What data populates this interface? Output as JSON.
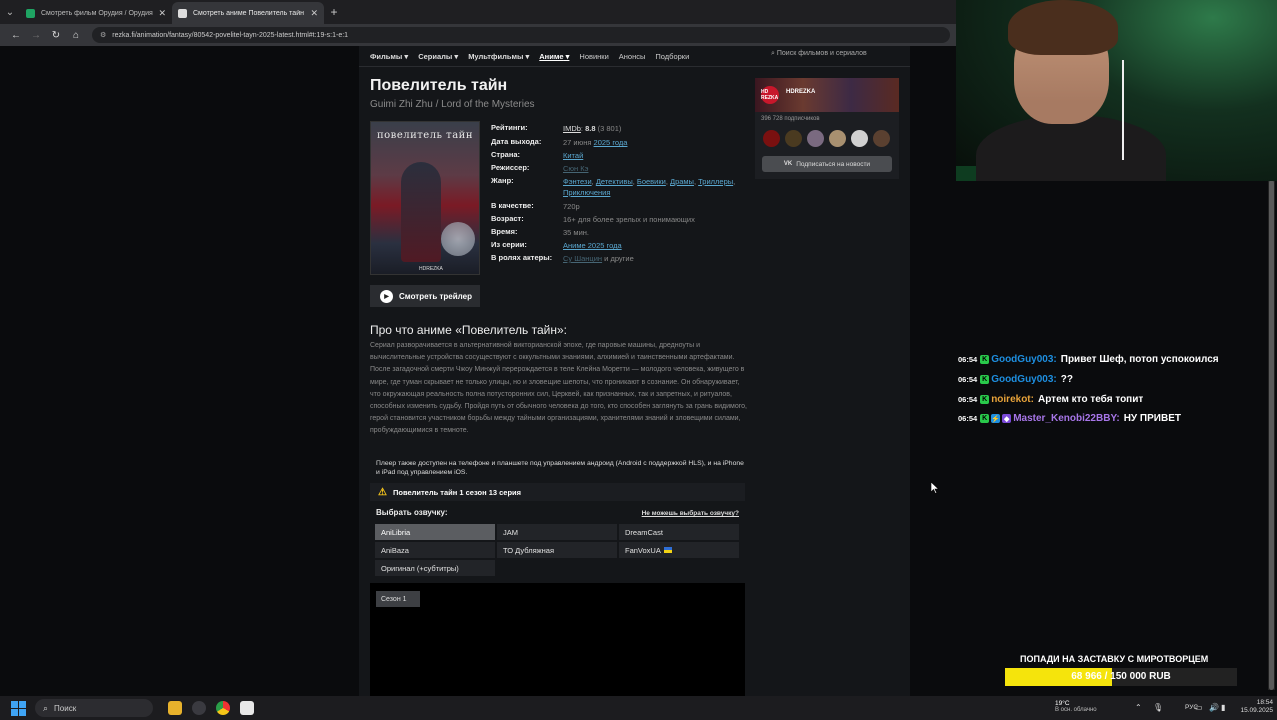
{
  "browser": {
    "tabs": [
      {
        "title": "Смотреть фильм Орудия / Орудия",
        "favicon_color": "#1fa463",
        "active": false
      },
      {
        "title": "Смотреть аниме Повелитель тайн",
        "favicon_color": "#ffffff",
        "active": true
      }
    ],
    "url": "rezka.fi/animation/fantasy/80542-povelitel-tayn-2025-latest.html#t:19-s:1-e:1"
  },
  "nav": {
    "items": [
      "Фильмы",
      "Сериалы",
      "Мультфильмы",
      "Аниме",
      "Новинки",
      "Анонсы",
      "Подборки"
    ],
    "search_placeholder": "Поиск фильмов и сериалов"
  },
  "movie": {
    "title": "Повелитель тайн",
    "original_title": "Guimi Zhi Zhu / Lord of the Mysteries",
    "poster_title": "повелитель тайн",
    "poster_logo": "HDREZKA",
    "trailer_label": "Смотреть трейлер",
    "info": {
      "ratings_label": "Рейтинги:",
      "imdb": "IMDb",
      "imdb_score": "8.8",
      "imdb_votes": "(3 801)",
      "release_label": "Дата выхода:",
      "release_date": "27 июня",
      "release_year": "2025 года",
      "country_label": "Страна:",
      "country": "Китай",
      "director_label": "Режиссер:",
      "director": "Сюн Кэ",
      "genre_label": "Жанр:",
      "genres": [
        "Фэнтези",
        "Детективы",
        "Боевики",
        "Драмы",
        "Триллеры",
        "Приключения"
      ],
      "quality_label": "В качестве:",
      "quality": "720p",
      "age_label": "Возраст:",
      "age": "16+",
      "age_note": "для более зрелых и понимающих",
      "time_label": "Время:",
      "time": "35 мин.",
      "series_label": "Из серии:",
      "series": "Аниме 2025 года",
      "actors_label": "В ролях актеры:",
      "actor": "Су Шанцин",
      "actors_more": "и другие"
    },
    "about_heading": "Про что аниме «Повелитель тайн»:",
    "about_text": "Сериал разворачивается в альтернативной викторианской эпохе, где паровые машины, дредноуты и вычислительные устройства сосуществуют с оккультными знаниями, алхимией и таинственными артефактами. После загадочной смерти Чжоу Минжуй перерождается в теле Клейна Моретти — молодого человека, живущего в мире, где туман скрывает не только улицы, но и зловещие шепоты, что проникают в сознание. Он обнаруживает, что окружающая реальность полна потусторонних сил, Церквей, как признанных, так и запретных, и ритуалов, способных изменить судьбу. Пройдя путь от обычного человека до того, кто способен заглянуть за грань видимого, герой становится участником борьбы между тайными организациями, хранителями знаний и зловещими силами, пробуждающимися в темноте."
  },
  "player": {
    "note": "Плеер также доступен на телефоне и планшете под управлением андроид (Android с поддержкой HLS), и на iPhone и iPad под управлением iOS.",
    "episode_title": "Повелитель тайн 1 сезон 13 серия",
    "voice_heading": "Выбрать озвучку:",
    "voice_help": "Не можешь выбрать озвучку?",
    "voices": [
      "AniLibria",
      "JAM",
      "DreamCast",
      "AniBaza",
      "ТО Дубляжная",
      "FanVoxUA",
      "Оригинал (+субтитры)"
    ],
    "active_voice": "AniLibria",
    "season_label": "Сезон 1"
  },
  "vk_widget": {
    "name": "HDREZKA",
    "logo_text": "HD REZKA",
    "subscribers": "396 728 подписчиков",
    "subscribe_label": "Подписаться на новости",
    "vk_icon": "VK"
  },
  "chat": [
    {
      "time": "06:54",
      "user": "GoodGuy003:",
      "user_color": "#1e8fe0",
      "msg": "Привет Шеф, потоп успокоился",
      "badges": 1
    },
    {
      "time": "06:54",
      "user": "GoodGuy003:",
      "user_color": "#1e8fe0",
      "msg": "??",
      "badges": 1
    },
    {
      "time": "06:54",
      "user": "noirekot:",
      "user_color": "#e8a33a",
      "msg": "Артем кто тебя топит",
      "badges": 1
    },
    {
      "time": "06:54",
      "user": "Master_Kenobi22BBY:",
      "user_color": "#a776e8",
      "msg": "НУ ПРИВЕТ",
      "badges": 3
    }
  ],
  "donation": {
    "heading": "ПОПАДИ НА ЗАСТАВКУ С МИРОТВОРЦЕМ",
    "current": "68 966",
    "goal": "150 000 RUB",
    "progress": 0.46
  },
  "taskbar": {
    "search_label": "Поиск",
    "weather_temp": "19°C",
    "weather_desc": "В осн. облачно",
    "weather_badge": "1",
    "lang": "РУС",
    "time": "18:54",
    "date": "15.09.2025"
  }
}
